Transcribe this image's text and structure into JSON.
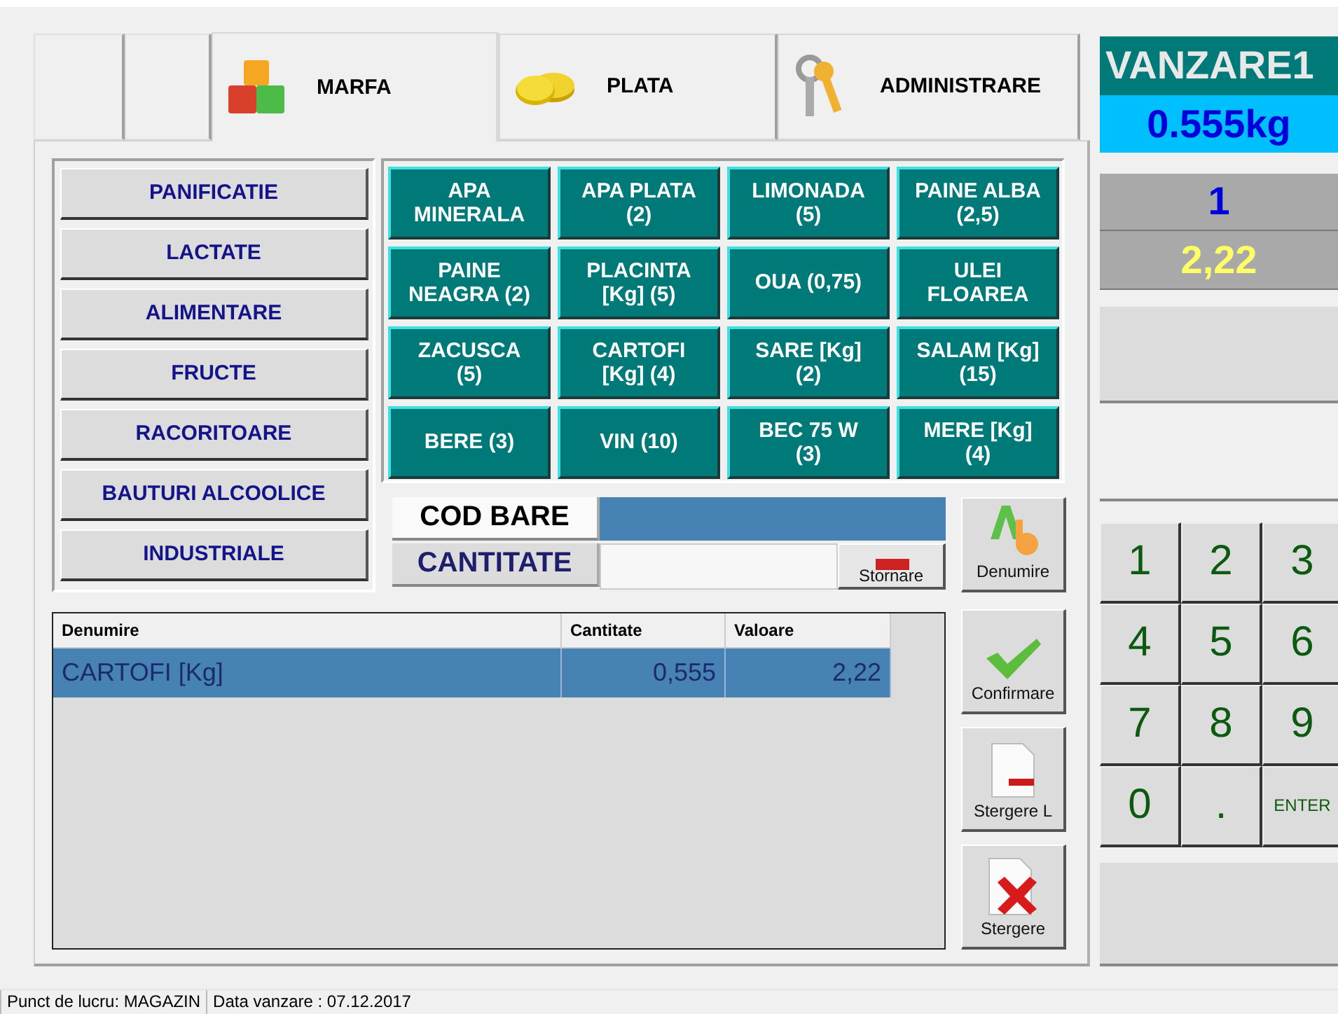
{
  "tabs": [
    {
      "label": "MARFA",
      "selected": true
    },
    {
      "label": "PLATA",
      "selected": false
    },
    {
      "label": "ADMINISTRARE",
      "selected": false
    }
  ],
  "categories": [
    "PANIFICATIE",
    "LACTATE",
    "ALIMENTARE",
    "FRUCTE",
    "RACORITOARE",
    "BAUTURI ALCOOLICE",
    "INDUSTRIALE"
  ],
  "products": [
    "APA\nMINERALA",
    "APA PLATA\n(2)",
    "LIMONADA\n(5)",
    "PAINE ALBA\n(2,5)",
    "PAINE\nNEAGRA (2)",
    "PLACINTA\n[Kg] (5)",
    "OUA (0,75)",
    "ULEI\nFLOAREA",
    "ZACUSCA\n(5)",
    "CARTOFI\n[Kg] (4)",
    "SARE [Kg]\n(2)",
    "SALAM [Kg]\n(15)",
    "BERE (3)",
    "VIN (10)",
    "BEC 75 W\n(3)",
    "MERE [Kg]\n(4)"
  ],
  "barcode": {
    "label": "COD BARE"
  },
  "quantity": {
    "label": "CANTITATE",
    "button": "Stornare"
  },
  "side_buttons": [
    {
      "label": "Denumire",
      "kind": "name"
    },
    {
      "label": "Confirmare",
      "kind": "confirm"
    },
    {
      "label": "Stergere L",
      "kind": "delete_line"
    },
    {
      "label": "Stergere",
      "kind": "delete"
    }
  ],
  "table": {
    "columns": [
      "Denumire",
      "Cantitate",
      "Valoare"
    ],
    "rows": [
      {
        "cells": [
          "CARTOFI [Kg]",
          "0,555",
          "2,22"
        ],
        "selected": true
      }
    ]
  },
  "display": {
    "title": "VANZARE1",
    "weight": "0.555kg",
    "count": "1",
    "total": "2,22"
  },
  "keypad": [
    {
      "label": "1",
      "kind": "digit"
    },
    {
      "label": "2",
      "kind": "digit"
    },
    {
      "label": "3",
      "kind": "digit"
    },
    {
      "label": "4",
      "kind": "digit"
    },
    {
      "label": "5",
      "kind": "digit"
    },
    {
      "label": "6",
      "kind": "digit"
    },
    {
      "label": "7",
      "kind": "digit"
    },
    {
      "label": "8",
      "kind": "digit"
    },
    {
      "label": "9",
      "kind": "digit"
    },
    {
      "label": "0",
      "kind": "digit"
    },
    {
      "label": ".",
      "kind": "digit"
    },
    {
      "label": "ENTER",
      "kind": "action"
    }
  ],
  "status_bar": [
    "Punct de lucru: MAGAZIN",
    "Data vanzare : 07.12.2017"
  ]
}
